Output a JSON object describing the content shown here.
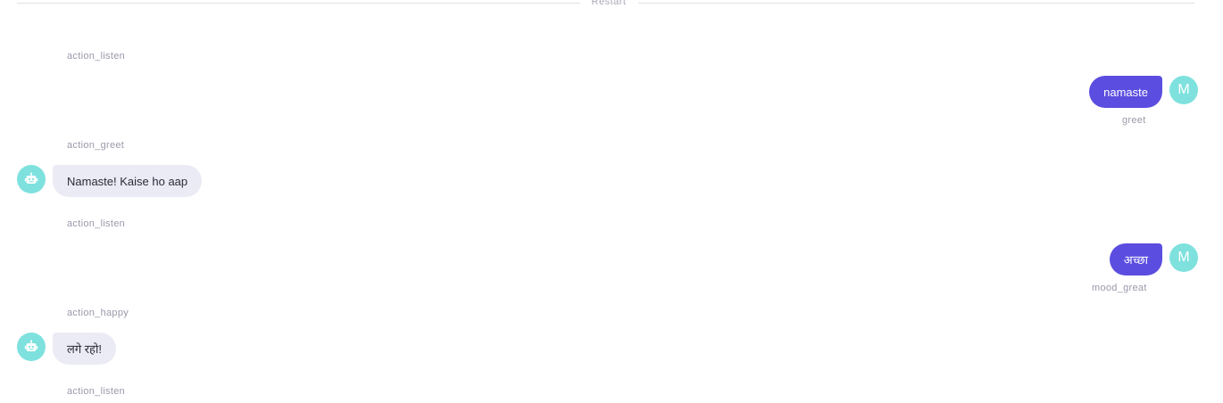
{
  "conversation": {
    "restart_label": "Restart",
    "user_initial": "M",
    "events": [
      {
        "type": "action",
        "label": "action_listen"
      },
      {
        "type": "user",
        "text": "namaste",
        "intent": "greet"
      },
      {
        "type": "action",
        "label": "action_greet"
      },
      {
        "type": "bot",
        "text": "Namaste! Kaise ho aap"
      },
      {
        "type": "action",
        "label": "action_listen"
      },
      {
        "type": "user",
        "text": "अच्छा",
        "intent": "mood_great"
      },
      {
        "type": "action",
        "label": "action_happy"
      },
      {
        "type": "bot",
        "text": "लगे रहो!"
      },
      {
        "type": "action",
        "label": "action_listen"
      }
    ]
  },
  "colors": {
    "user_bubble": "#5b4de0",
    "bot_bubble": "#ebebf5",
    "avatar": "#7ee1de"
  },
  "icons": {
    "bot_avatar": "robot-icon"
  }
}
